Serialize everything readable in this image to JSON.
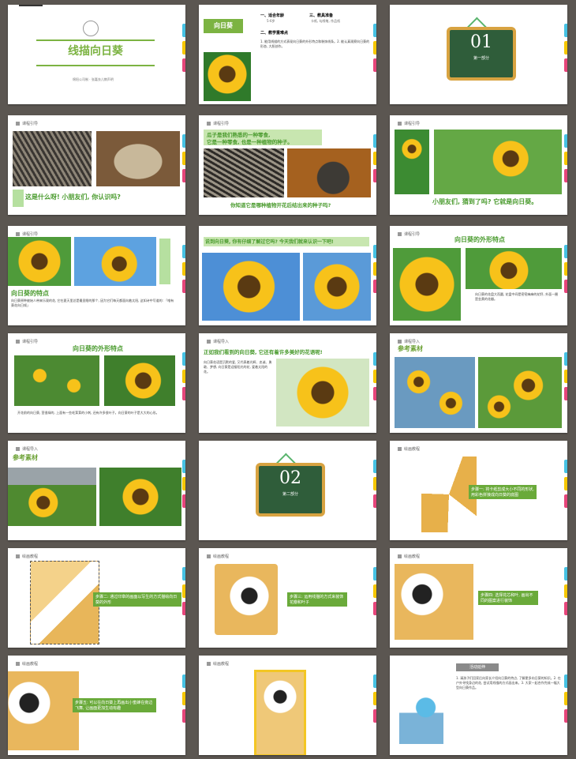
{
  "slides": {
    "s1": {
      "title": "线描向日葵",
      "sub": "绵阳公司制  · 张嘉衣儿教声明"
    },
    "s2": {
      "tag": "向日葵",
      "h1": "一、适合年龄",
      "h1v": "5-6岁",
      "h2": "三、教具准备",
      "h2v": "卡纸, 勾线笔, 作品纸",
      "h3": "二、教学重难点",
      "body": "1. 能用线描的方式表现向日葵的外形特点和装饰线条。2. 能认真观察向日葵的形态, 大胆创作。"
    },
    "s3": {
      "num": "01",
      "label": "第一部分"
    },
    "s4": {
      "header": "课程引导",
      "caption": "这是什么呀! 小朋友们, 你认识吗?"
    },
    "s5": {
      "header": "课程引导",
      "top": "瓜子是我们熟悉的一种零食,",
      "top2": "它是一种零食, 也是一种植物的种子。",
      "bottom": "你知道它是哪种植物开花后结出来的种子吗?"
    },
    "s6": {
      "header": "课程引导",
      "caption": "小朋友们, 猜到了吗? 它就是向日葵。"
    },
    "s7": {
      "header": "课程引导",
      "title": "向日葵的特点",
      "body": "向日葵原种被始人带来乐观的花, 它在夏天里总是最显眼的那个, 因为它们每天都面向着太阳, 这如诗中写道的: 「唯有葵花向日倾」"
    },
    "s8": {
      "caption": "说到向日葵, 你有仔细了解过它吗? 今天我们就来认识一下吧!"
    },
    "s9": {
      "header": "课程引导",
      "title": "向日葵的外形特点",
      "body": "向日葵的花盘大而圆, 花盘中间是密密麻麻的花籽, 外面一圈是金黄的花瓣。"
    },
    "s10": {
      "header": "课程引导",
      "title": "向日葵的外形特点",
      "body": "开花前的向日葵, 茎很绿的, 上面有一些毛茸茸的小刺, 还有许多很叶子。向日葵的叶子是大大的心形。"
    },
    "s11": {
      "header": "课程导入",
      "title": "正如我们看到的向日葵, 它还有着许多美好的花语呢!",
      "body": "向日葵花语是沉默的爱, 又代表着光辉、忠诚、勇敢、梦想, 向日葵是迎接阳光的花, 爱着太阳的花。"
    },
    "s12": {
      "header": "课程导入",
      "title": "参考素材"
    },
    "s13": {
      "header": "课程导入",
      "title": "参考素材"
    },
    "s14": {
      "num": "02",
      "label": "第二部分"
    },
    "s15": {
      "header": "绘画教程",
      "step": "步骤一: 将卡纸剪成大小不同的形状, 用彩色拼接成向日葵的底图"
    },
    "s16": {
      "header": "绘画教程",
      "step": "步骤二: 通过印章的画面以写生的方式描绘向日葵的外形"
    },
    "s17": {
      "header": "绘画教程",
      "step": "步骤三: 运用线描的方式来装饰花瓣和叶子"
    },
    "s18": {
      "header": "绘画教程",
      "step": "步骤四: 选择花芯和叶, 画出不同的图案进行装饰"
    },
    "s19": {
      "header": "绘画教程",
      "step": "步骤五: 可以在向日葵上再画出小蜜蜂在旁边飞舞, 让画面更加生动有趣"
    },
    "s20": {
      "header": "绘画教程"
    },
    "s21": {
      "title": "活动延伸",
      "body": "1. 请孩子们回家后向家长介绍向日葵的特点, 了解更多向日葵的知识。2. 在户外寻找身边的花, 尝试用线描的方式画出来。3. 大家一起合作完成一幅大型向日葵作品。"
    }
  }
}
